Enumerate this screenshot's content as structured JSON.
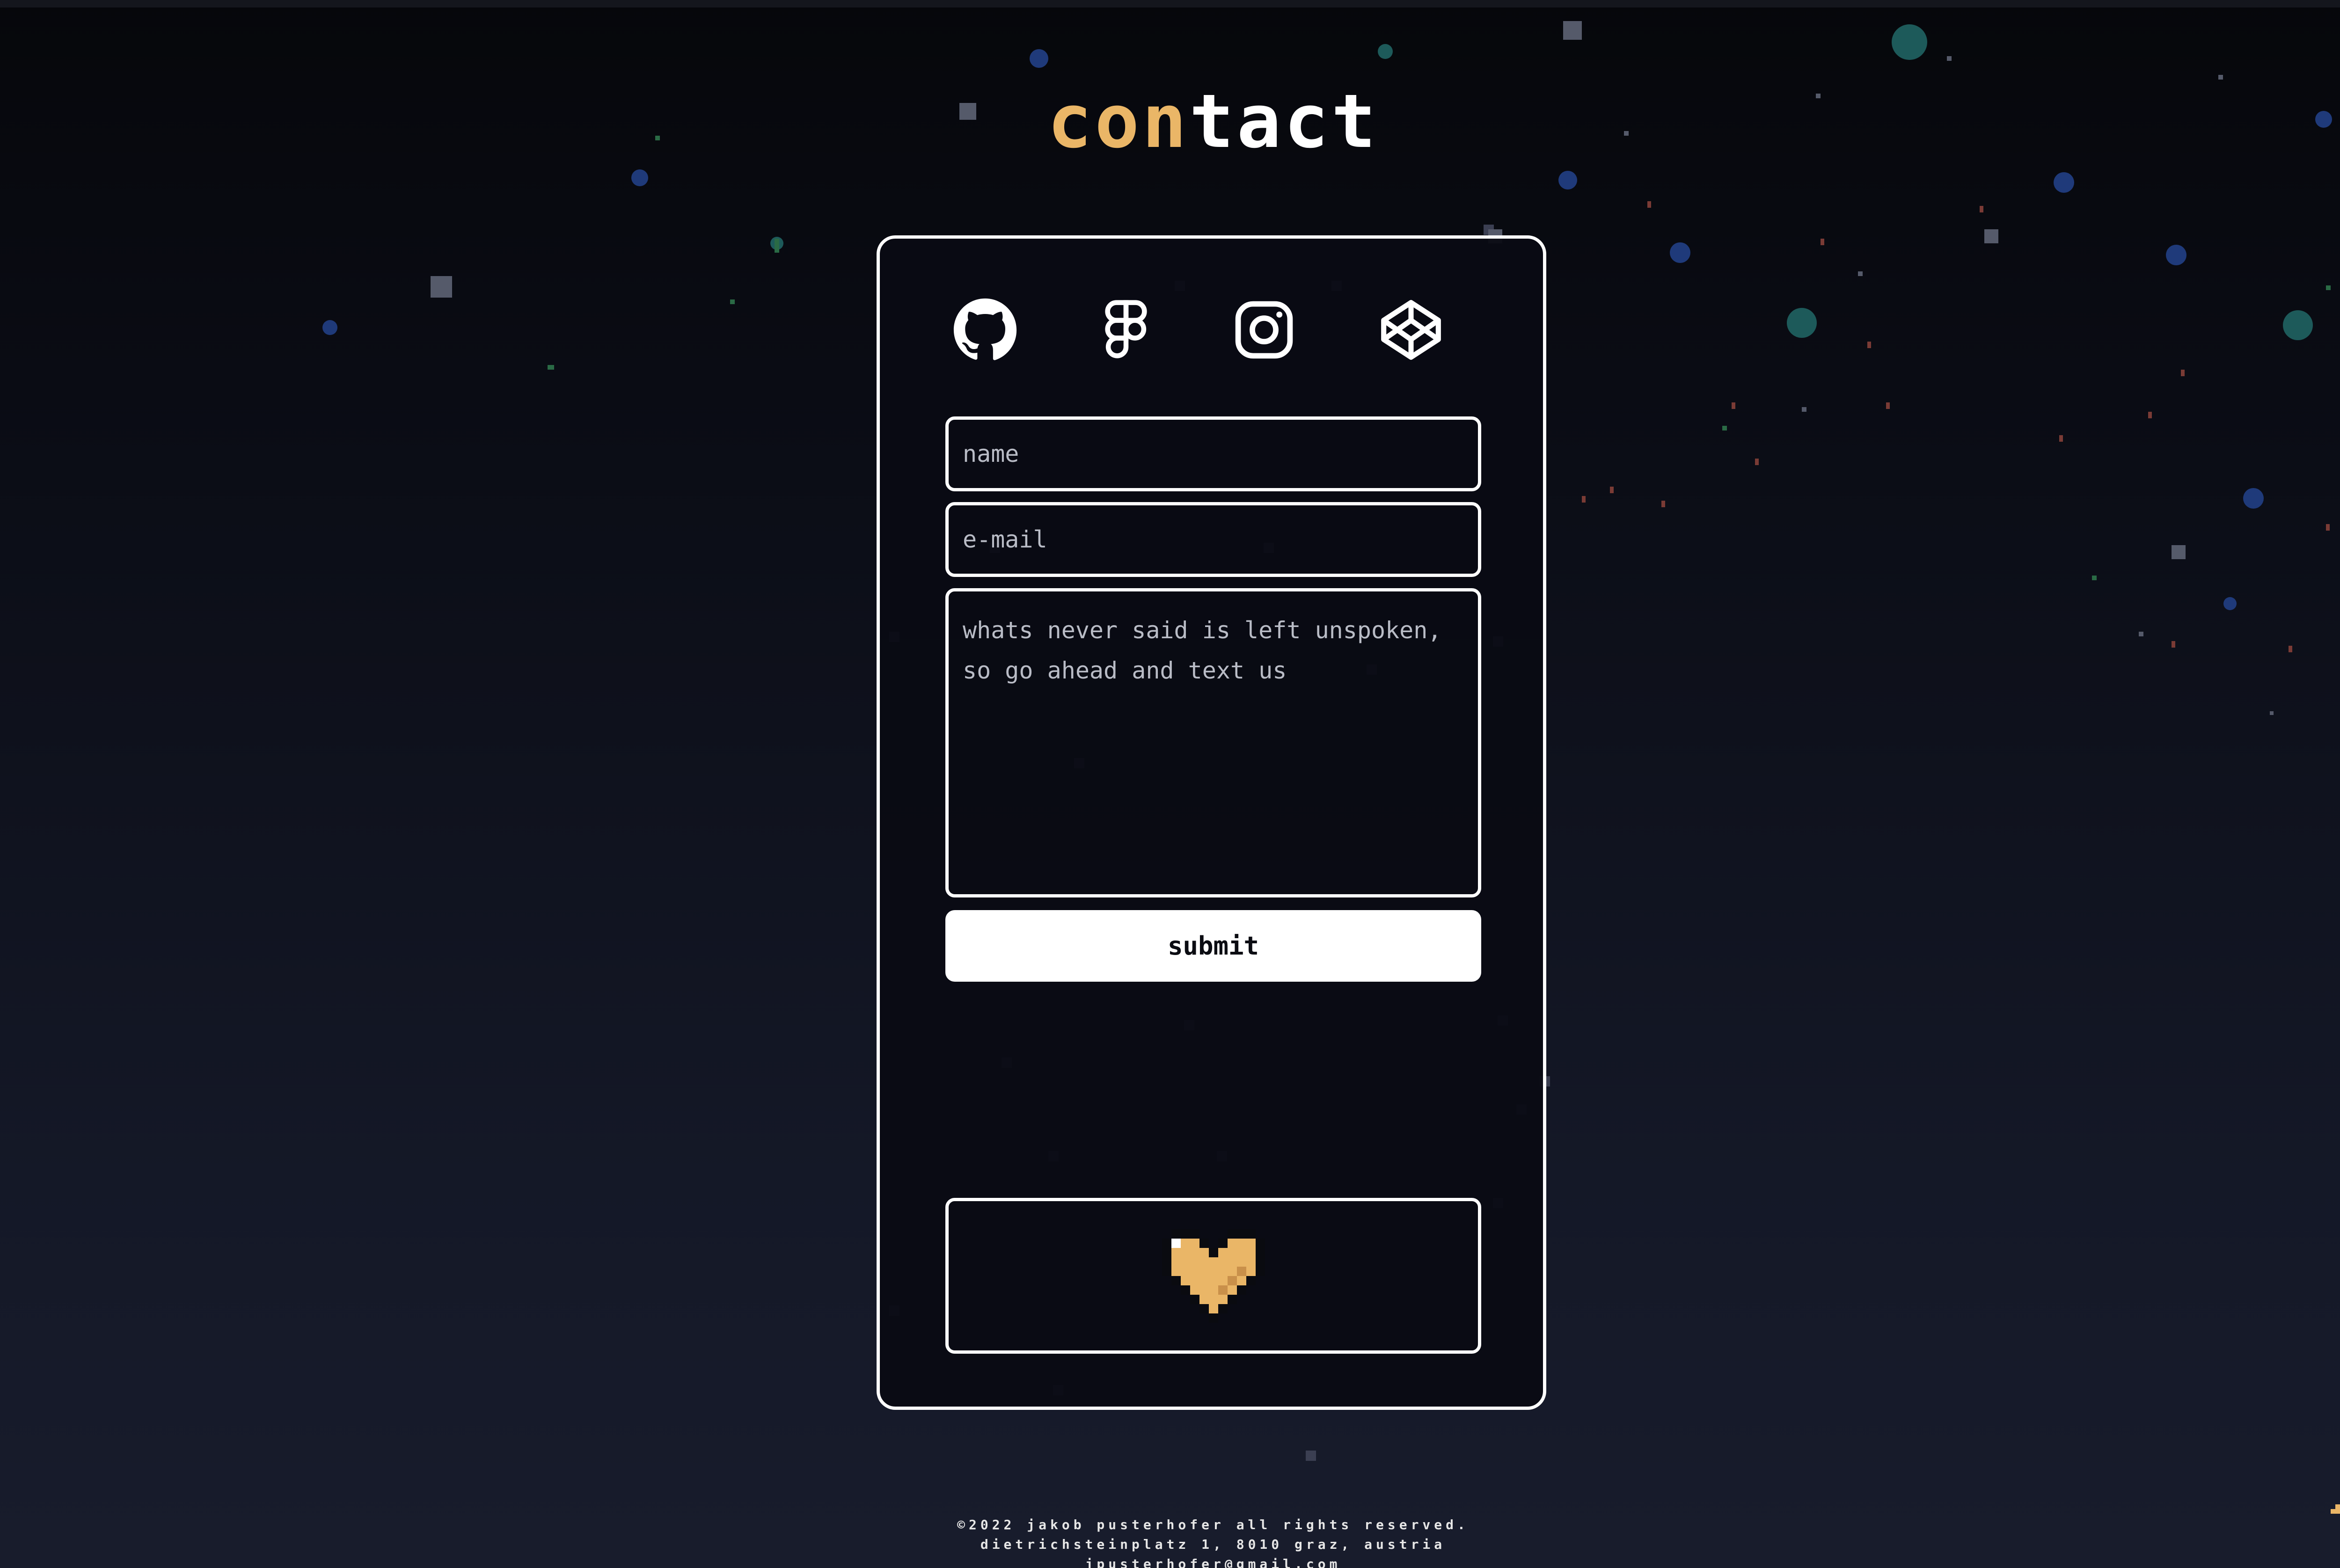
{
  "title": {
    "accent": "con",
    "rest": "tact"
  },
  "social": [
    {
      "name": "github",
      "icon": "github-icon"
    },
    {
      "name": "figma",
      "icon": "figma-icon"
    },
    {
      "name": "instagram",
      "icon": "instagram-icon"
    },
    {
      "name": "codepen",
      "icon": "codepen-icon"
    }
  ],
  "form": {
    "name_placeholder": "name",
    "email_placeholder": "e-mail",
    "message_placeholder": "whats never said is left unspoken, so go ahead and text us",
    "submit_label": "submit"
  },
  "decoration": {
    "icon": "pixel-heart-icon",
    "color": "#eab667"
  },
  "footer": {
    "copyright": "©2022 jakob pusterhofer all rights reserved.",
    "address": "dietrichsteinplatz 1, 8010 graz, austria",
    "email": "jpusterhofer@gmail.com"
  },
  "scroll_top": {
    "icon": "chevron-up-icon",
    "color": "#eab667"
  },
  "colors": {
    "accent": "#eab667",
    "background_top": "#06070b",
    "background_bottom": "#181c2c",
    "border": "#ffffff"
  }
}
